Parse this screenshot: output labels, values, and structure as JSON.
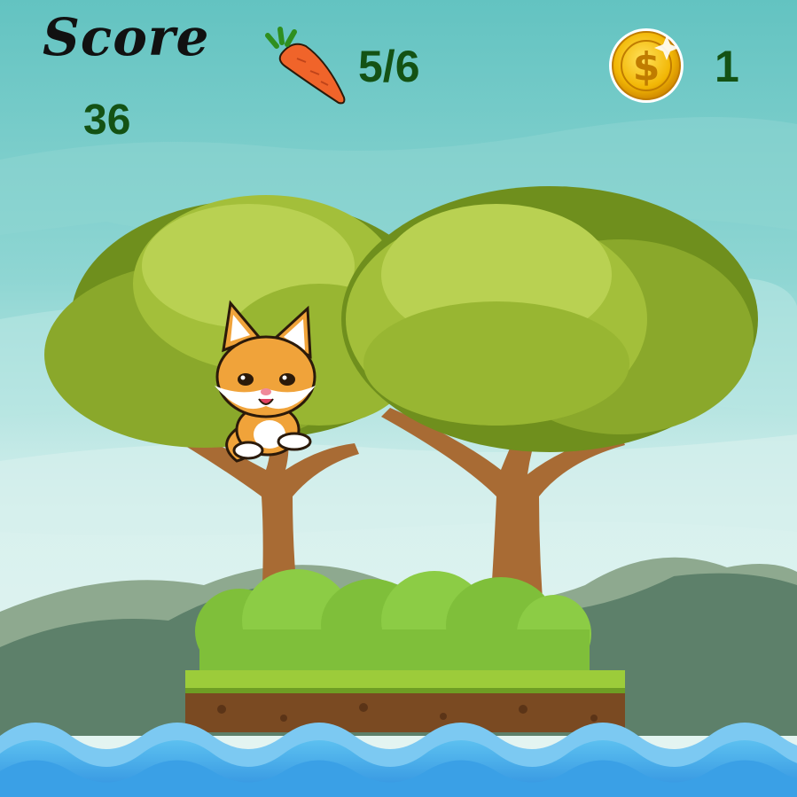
{
  "hud": {
    "score_label": "Score",
    "score_value": "36",
    "carrots": "5/6",
    "coins": "1"
  },
  "icons": {
    "carrot": "carrot-icon",
    "coin": "coin-icon",
    "coin_symbol": "$"
  },
  "colors": {
    "sky": "#6cc7c4",
    "hud_text": "#145214",
    "water": "#41a7e8",
    "coin": "#f2b705",
    "carrot": "#f0642a",
    "grass": "#9ccc3a"
  }
}
